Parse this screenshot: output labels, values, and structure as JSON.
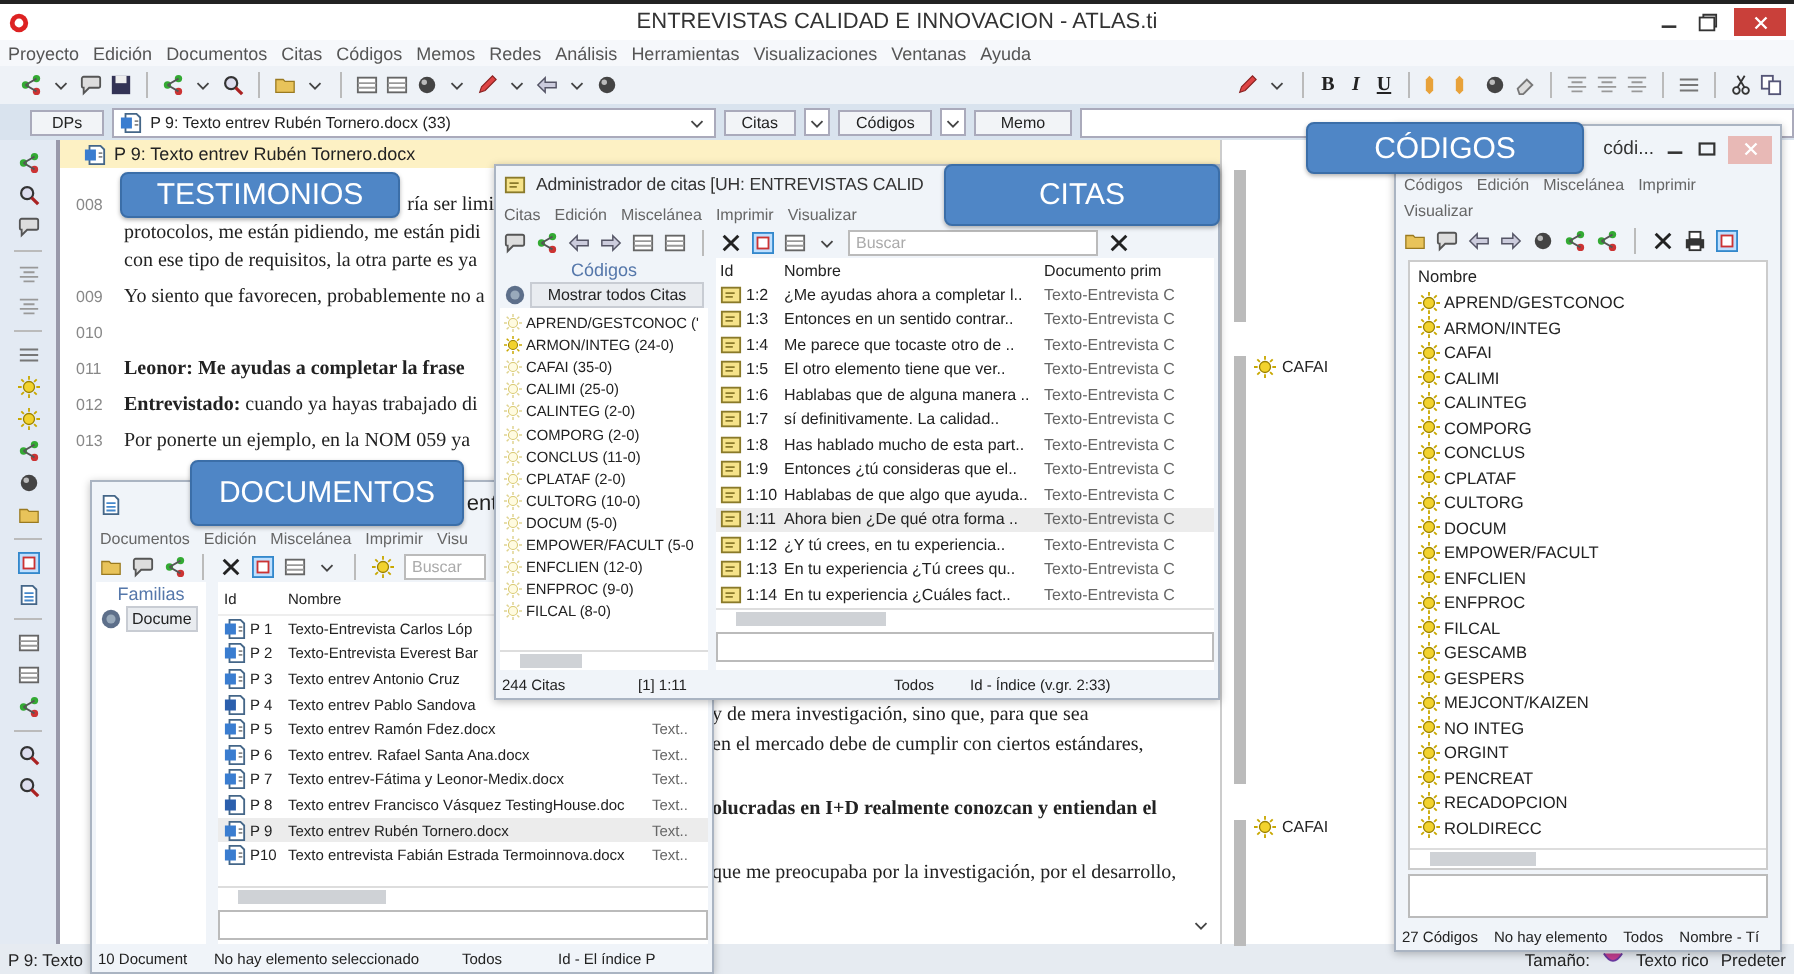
{
  "window": {
    "title": "ENTREVISTAS CALIDAD E INNOVACION - ATLAS.ti"
  },
  "menu": [
    "Proyecto",
    "Edición",
    "Documentos",
    "Citas",
    "Códigos",
    "Memos",
    "Redes",
    "Análisis",
    "Herramientas",
    "Visualizaciones",
    "Ventanas",
    "Ayuda"
  ],
  "format_buttons": [
    "B",
    "I",
    "U"
  ],
  "selector_bar": {
    "documents_button": "DPs",
    "document_dropdown": "P 9: Texto entrev Rubén Tornero.docx (33)",
    "quotes_button": "Citas",
    "codes_button": "Códigos",
    "memo_button": "Memo"
  },
  "document": {
    "title": "P 9: Texto entrev Rubén Tornero.docx",
    "upper_paragraphs": [
      {
        "number": "008",
        "lines": [
          {
            "text": "ría ser limi",
            "kind": "tail"
          },
          {
            "text": "protocolos, me están pidiendo, me están pidi",
            "kind": "plain"
          },
          {
            "text": "con ese tipo de requisitos, la otra parte es ya",
            "kind": "plain"
          }
        ]
      },
      {
        "number": "009",
        "lines": [
          {
            "text": "Yo siento que favorecen, probablemente no a",
            "kind": "plain"
          }
        ]
      },
      {
        "number": "010"
      },
      {
        "number": "011",
        "lines": [
          {
            "text": "Leonor: Me ayudas a completar la frase",
            "kind": "bold"
          }
        ]
      },
      {
        "number": "012",
        "lines": [
          {
            "text": "**Entrevistado:** cuando ya hayas trabajado di",
            "kind": "plain"
          }
        ]
      },
      {
        "number": "013",
        "lines": [
          {
            "text": "Por ponerte un ejemplo, en la NOM 059 ya",
            "kind": "plain"
          }
        ]
      }
    ],
    "lower_paragraphs": [
      {
        "lines": [
          {
            "text": "y de mera investigación, sino que, para que sea",
            "kind": "plain"
          },
          {
            "text": "en el mercado debe de cumplir con ciertos estándares,",
            "kind": "plain"
          }
        ]
      },
      {
        "lines": [
          {
            "text": "olucradas en I+D realmente conozcan y entiendan el",
            "kind": "bold"
          }
        ]
      },
      {
        "lines": [
          {
            "text": "que me preocupaba por la investigación, por el desarrollo,",
            "kind": "plain"
          }
        ]
      }
    ]
  },
  "margin_codes": [
    "CAFAI",
    "CAFAI"
  ],
  "callouts": [
    "TESTIMONIOS",
    "CITAS",
    "DOCUMENTOS",
    "CÓDIGOS"
  ],
  "quotations_manager": {
    "title": "Administrador de citas [UH: ENTREVISTAS CALID",
    "menu": [
      "Citas",
      "Edición",
      "Miscelánea",
      "Imprimir",
      "Visualizar"
    ],
    "search": {
      "placeholder": "Buscar"
    },
    "codes_header": "Códigos",
    "show_all_button": "Mostrar todos Citas",
    "codes": [
      {
        "label": "APREND/GESTCONOC ('",
        "highlighted": false
      },
      {
        "label": "ARMON/INTEG (24-0)",
        "highlighted": true
      },
      {
        "label": "CAFAI (35-0)",
        "highlighted": false
      },
      {
        "label": "CALIMI (25-0)",
        "highlighted": false
      },
      {
        "label": "CALINTEG (2-0)",
        "highlighted": false
      },
      {
        "label": "COMPORG (2-0)",
        "highlighted": false
      },
      {
        "label": "CONCLUS (11-0)",
        "highlighted": false
      },
      {
        "label": "CPLATAF (2-0)",
        "highlighted": false
      },
      {
        "label": "CULTORG (10-0)",
        "highlighted": false
      },
      {
        "label": "DOCUM (5-0)",
        "highlighted": false
      },
      {
        "label": "EMPOWER/FACULT (5-0",
        "highlighted": false
      },
      {
        "label": "ENFCLIEN (12-0)",
        "highlighted": false
      },
      {
        "label": "ENFPROC (9-0)",
        "highlighted": false
      },
      {
        "label": "FILCAL (8-0)",
        "highlighted": false
      }
    ],
    "columns": [
      "Id",
      "Nombre",
      "Documento prim"
    ],
    "rows": [
      {
        "id": "1:2",
        "name": "¿Me ayudas ahora a completar l..",
        "document": "Texto-Entrevista C",
        "selected": false
      },
      {
        "id": "1:3",
        "name": "Entonces en un sentido contrar..",
        "document": "Texto-Entrevista C",
        "selected": false
      },
      {
        "id": "1:4",
        "name": "Me parece que tocaste otro de ..",
        "document": "Texto-Entrevista C",
        "selected": false
      },
      {
        "id": "1:5",
        "name": "El otro elemento tiene que ver..",
        "document": "Texto-Entrevista C",
        "selected": false
      },
      {
        "id": "1:6",
        "name": "Hablabas que de alguna manera ..",
        "document": "Texto-Entrevista C",
        "selected": false
      },
      {
        "id": "1:7",
        "name": "sí definitivamente. La calidad..",
        "document": "Texto-Entrevista C",
        "selected": false
      },
      {
        "id": "1:8",
        "name": "Has hablado mucho de esta part..",
        "document": "Texto-Entrevista C",
        "selected": false
      },
      {
        "id": "1:9",
        "name": "Entonces ¿tú consideras que el..",
        "document": "Texto-Entrevista C",
        "selected": false
      },
      {
        "id": "1:10",
        "name": "Hablabas de que algo que ayuda..",
        "document": "Texto-Entrevista C",
        "selected": false
      },
      {
        "id": "1:11",
        "name": "Ahora bien ¿De qué otra forma ..",
        "document": "Texto-Entrevista C",
        "selected": true
      },
      {
        "id": "1:12",
        "name": "¿Y tú crees, en tu experiencia..",
        "document": "Texto-Entrevista C",
        "selected": false
      },
      {
        "id": "1:13",
        "name": "En tu experiencia ¿Tú crees qu..",
        "document": "Texto-Entrevista C",
        "selected": false
      },
      {
        "id": "1:14",
        "name": "En tu experiencia ¿Cuáles fact..",
        "document": "Texto-Entrevista C",
        "selected": false
      }
    ],
    "status": [
      "244 Citas",
      "[1] 1:11",
      "Todos",
      "Id - Índice (v.gr. 2:33)"
    ]
  },
  "documents_manager": {
    "title": "ent",
    "menu": [
      "Documentos",
      "Edición",
      "Miscelánea",
      "Imprimir",
      "Visu"
    ],
    "search": {
      "placeholder": "Buscar"
    },
    "families_header": "Familias",
    "family_button": "Docume",
    "columns": [
      "Id",
      "Nombre"
    ],
    "rows": [
      {
        "id": "P 1",
        "name": "Texto-Entrevista Carlos Lóp",
        "kind": "text",
        "selected": false
      },
      {
        "id": "P 2",
        "name": "Texto-Entrevista Everest Bar",
        "kind": "text",
        "selected": false
      },
      {
        "id": "P 3",
        "name": "Texto entrev Antonio Cruz",
        "kind": "text",
        "selected": false
      },
      {
        "id": "P 4",
        "name": "Texto entrev Pablo Sandova",
        "kind": "word",
        "selected": false
      },
      {
        "id": "P 5",
        "name": "Texto entrev Ramón Fdez.docx",
        "column_3": "Text..",
        "kind": "text",
        "selected": false
      },
      {
        "id": "P 6",
        "name": "Texto entrev. Rafael Santa Ana.docx",
        "column_3": "Text..",
        "kind": "text",
        "selected": false
      },
      {
        "id": "P 7",
        "name": "Texto entrev-Fátima y Leonor-Medix.docx",
        "column_3": "Text..",
        "kind": "text",
        "selected": false
      },
      {
        "id": "P 8",
        "name": "Texto entrev Francisco Vásquez TestingHouse.doc",
        "column_3": "Text..",
        "kind": "word",
        "selected": false
      },
      {
        "id": "P 9",
        "name": "Texto entrev Rubén Tornero.docx",
        "column_3": "Text..",
        "kind": "text",
        "selected": true
      },
      {
        "id": "P10",
        "name": "Texto entrevista Fabián Estrada Termoinnova.docx",
        "column_3": "Text..",
        "kind": "text",
        "selected": false
      }
    ],
    "status": [
      "10 Document",
      "No hay elemento seleccionado",
      "Todos",
      "Id - El índice P"
    ]
  },
  "codes_manager": {
    "title": "códi...",
    "menu": [
      "Códigos",
      "Edición",
      "Miscelánea",
      "Imprimir",
      "Visualizar"
    ],
    "column": "Nombre",
    "codes": [
      "APREND/GESTCONOC",
      "ARMON/INTEG",
      "CAFAI",
      "CALIMI",
      "CALINTEG",
      "COMPORG",
      "CONCLUS",
      "CPLATAF",
      "CULTORG",
      "DOCUM",
      "EMPOWER/FACULT",
      "ENFCLIEN",
      "ENFPROC",
      "FILCAL",
      "GESCAMB",
      "GESPERS",
      "MEJCONT/KAIZEN",
      "NO INTEG",
      "ORGINT",
      "PENCREAT",
      "RECADOPCION",
      "ROLDIRECC"
    ],
    "status": [
      "27 Códigos",
      "No hay elemento",
      "Todos",
      "Nombre - Tí"
    ]
  },
  "status_bar": {
    "left": "P 9: Texto",
    "right": [
      "Tamaño:",
      "Texto rico",
      "Predeter"
    ]
  }
}
